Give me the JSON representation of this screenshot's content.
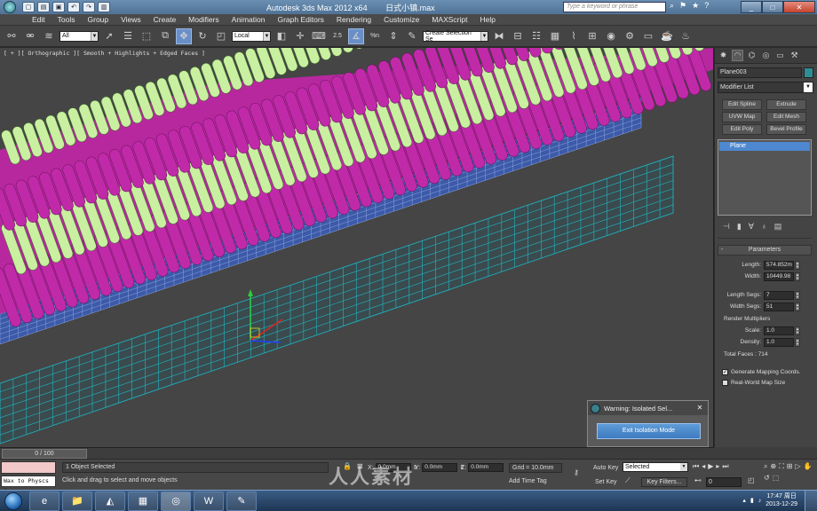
{
  "title_bar": {
    "app_title": "Autodesk 3ds Max  2012 x64",
    "file_name": "日式小镇.max",
    "search_placeholder": "Type a keyword or phrase",
    "quick_access_icons": [
      "new-icon",
      "open-icon",
      "save-icon",
      "undo-icon",
      "redo-icon",
      "project-icon"
    ]
  },
  "menu": {
    "items": [
      "Edit",
      "Tools",
      "Group",
      "Views",
      "Create",
      "Modifiers",
      "Animation",
      "Graph Editors",
      "Rendering",
      "Customize",
      "MAXScript",
      "Help"
    ]
  },
  "toolbar": {
    "selection_filter": "All",
    "reference_coord": "Local",
    "named_selection_placeholder": "Create Selection Se",
    "snap_label": "2.5",
    "percent_label": "%n",
    "icons": [
      "link-icon",
      "unlink-icon",
      "bind-space-warp-icon",
      "select-object-icon",
      "select-by-name-icon",
      "rect-region-icon",
      "window-crossing-icon",
      "select-move-icon",
      "select-rotate-icon",
      "select-scale-icon",
      "pivot-center-icon",
      "select-manipulate-icon",
      "keyboard-shortcut-icon",
      "snap-toggle-icon",
      "angle-snap-icon",
      "percent-snap-icon",
      "spinner-snap-icon",
      "edit-named-sets-icon",
      "mirror-icon",
      "align-icon",
      "layer-manager-icon",
      "graphite-toolbar-icon",
      "curve-editor-icon",
      "schematic-view-icon",
      "material-editor-icon",
      "render-setup-icon",
      "rendered-frame-icon",
      "render-icon",
      "teapot-icon"
    ]
  },
  "viewport": {
    "label": "[ + ][ Orthographic ][ Smooth + Highlights + Edged Faces ]",
    "colors": {
      "background": "#454545",
      "roof_magenta": "#c02aa8",
      "roof_green": "#c8f0a0",
      "plane_wire": "#1f8e9a",
      "blue_strip": "#4a6cc0"
    }
  },
  "command_panel": {
    "tabs": [
      "create-icon",
      "modify-icon",
      "hierarchy-icon",
      "motion-icon",
      "display-icon",
      "utilities-icon"
    ],
    "object_name": "Plane003",
    "modifier_list": "Modifier List",
    "mod_buttons": [
      "Edit Spline",
      "Extrude",
      "UVW Map",
      "Edit Mesh",
      "Edit Poly",
      "Bevel Profile"
    ],
    "stack_items": [
      "Plane"
    ],
    "stack_tools": [
      "pin-stack-icon",
      "show-end-result-icon",
      "make-unique-icon",
      "remove-modifier-icon",
      "configure-modifier-sets-icon"
    ],
    "parameters_title": "Parameters",
    "length_label": "Length:",
    "length_value": "574.852m",
    "width_label": "Width:",
    "width_value": "10449.98",
    "length_segs_label": "Length Segs:",
    "length_segs_value": "7",
    "width_segs_label": "Width Segs:",
    "width_segs_value": "51",
    "render_multipliers": "Render Multipliers",
    "scale_label": "Scale:",
    "scale_value": "1.0",
    "density_label": "Density:",
    "density_value": "1.0",
    "total_faces": "Total Faces : 714",
    "generate_mapping": "Generate Mapping Coords.",
    "generate_mapping_checked": true,
    "real_world": "Real-World Map Size",
    "real_world_checked": false
  },
  "warning_dialog": {
    "title": "Warning: Isolated Sel...",
    "button": "Exit Isolation Mode"
  },
  "time_slider": {
    "position": "0 / 100"
  },
  "status": {
    "maxscript_listener": "Wax to Physcs (",
    "selection_info": "1 Object Selected",
    "prompt": "Click and drag to select and move objects",
    "x_label": "X:",
    "x_value": "0.0mm",
    "y_label": "Y:",
    "y_value": "0.0mm",
    "z_label": "Z:",
    "z_value": "0.0mm",
    "grid": "Grid = 10.0mm",
    "add_time_tag": "Add Time Tag",
    "auto_key": "Auto Key",
    "set_key": "Set Key",
    "selected_dropdown": "Selected",
    "key_filters": "Key Filters...",
    "current_frame": "0"
  },
  "taskbar": {
    "apps": [
      "explorer-icon",
      "folder-icon",
      "nvidia-icon",
      "media-icon",
      "3dsmax-icon",
      "word-icon",
      "paint-icon"
    ],
    "time": "17:47 周日",
    "date": "2013-12-29"
  },
  "watermark": "人人素材"
}
